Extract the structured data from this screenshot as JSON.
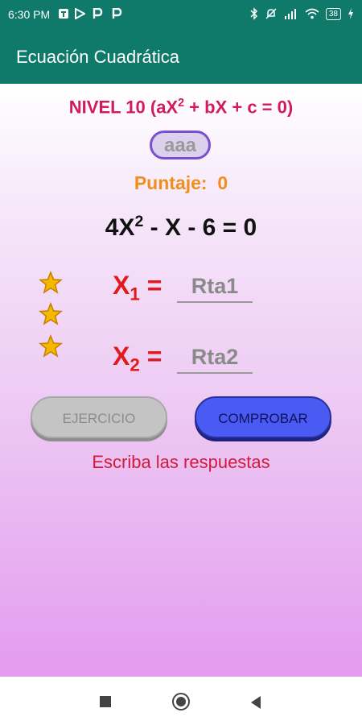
{
  "status_bar": {
    "time": "6:30 PM",
    "battery": "38",
    "icons": [
      "notification-icon",
      "play-store-icon",
      "parking-icon",
      "parking-icon",
      "bluetooth-icon",
      "silent-icon",
      "signal-icon",
      "wifi-icon",
      "battery-icon",
      "charging-icon"
    ]
  },
  "app_bar": {
    "title": "Ecuación Cuadrática"
  },
  "level": {
    "text": "NIVEL 10 (aX",
    "sup": "2",
    "rest": " + bX + c = 0)"
  },
  "user": {
    "name": "aaa"
  },
  "score": {
    "label": "Puntaje:",
    "value": "0"
  },
  "equation": {
    "part1": "4X",
    "sup": "2",
    "part2": " - X - 6 = 0"
  },
  "stars": {
    "count": 3,
    "color": "#f5b800"
  },
  "answers": [
    {
      "label": "X",
      "sub": "1",
      "eq": " =",
      "placeholder": "Rta1",
      "value": ""
    },
    {
      "label": "X",
      "sub": "2",
      "eq": " =",
      "placeholder": "Rta2",
      "value": ""
    }
  ],
  "buttons": {
    "exercise": "EJERCICIO",
    "check": "COMPROBAR"
  },
  "message": "Escriba las respuestas",
  "colors": {
    "accent": "#0f7a6a",
    "level": "#d11b5a",
    "score": "#ee8f1c",
    "x_label": "#e01b1b",
    "check_button": "#4a5bf3"
  }
}
